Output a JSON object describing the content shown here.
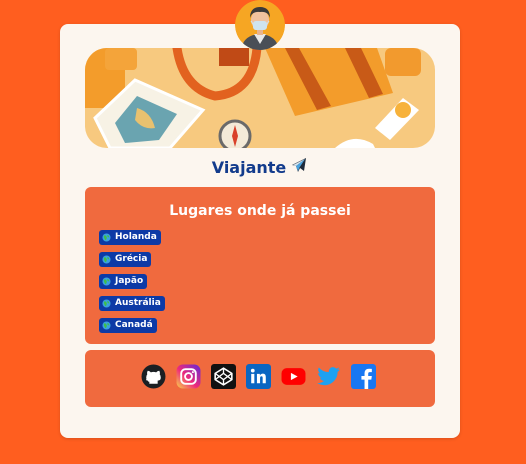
{
  "profile": {
    "name": "Viajante"
  },
  "places": {
    "title": "Lugares onde já passei",
    "items": [
      {
        "label": "Holanda"
      },
      {
        "label": "Grécia"
      },
      {
        "label": "Japão"
      },
      {
        "label": "Austrália"
      },
      {
        "label": "Canadá"
      }
    ]
  },
  "social": {
    "links": [
      {
        "icon": "github-icon"
      },
      {
        "icon": "instagram-icon"
      },
      {
        "icon": "codepen-icon"
      },
      {
        "icon": "linkedin-icon"
      },
      {
        "icon": "youtube-icon"
      },
      {
        "icon": "twitter-icon"
      },
      {
        "icon": "facebook-icon"
      }
    ]
  },
  "colors": {
    "background": "#ff5e1f",
    "card": "#fcf6ef",
    "panel": "#f06a3e",
    "name_text": "#123b8c",
    "badge": "#0d3aa6"
  }
}
